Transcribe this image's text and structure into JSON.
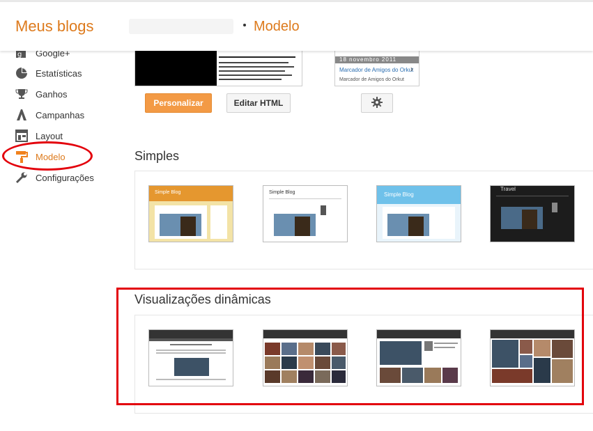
{
  "header": {
    "app_title": "Meus blogs",
    "page_title": "Modelo"
  },
  "sidebar": {
    "items": [
      {
        "label": "Google+",
        "icon": "google-plus-icon"
      },
      {
        "label": "Estatísticas",
        "icon": "pie-chart-icon"
      },
      {
        "label": "Ganhos",
        "icon": "trophy-icon"
      },
      {
        "label": "Campanhas",
        "icon": "campaign-icon"
      },
      {
        "label": "Layout",
        "icon": "layout-icon"
      },
      {
        "label": "Modelo",
        "icon": "paint-roller-icon",
        "active": true
      },
      {
        "label": "Configurações",
        "icon": "wrench-icon"
      }
    ]
  },
  "current": {
    "mobile_widget_date": "18 novembro 2011",
    "mobile_widget_link": "Marcador de Amigos do Orkut",
    "mobile_widget_text": "Marcador de Amigos do Orkut",
    "personalize_label": "Personalizar",
    "edit_html_label": "Editar HTML",
    "settings_icon": "gear-icon"
  },
  "sections": {
    "simple_title": "Simples",
    "dynamic_title": "Visualizações dinâmicas"
  },
  "simple_templates": [
    {
      "caption": "Simple Blog",
      "bg": "#f3e3a6",
      "head": "#e5972f"
    },
    {
      "caption": "Simple Blog",
      "bg": "#ffffff",
      "head": "#ffffff"
    },
    {
      "caption": "Simple Blog",
      "bg": "#e9f4fb",
      "head": "#6fc1ea"
    },
    {
      "caption": "Travel",
      "bg": "#1c1c1c",
      "head": "#2a2a2a"
    }
  ],
  "colors": {
    "accent": "#dd7a1c",
    "highlight": "#e3000b"
  }
}
